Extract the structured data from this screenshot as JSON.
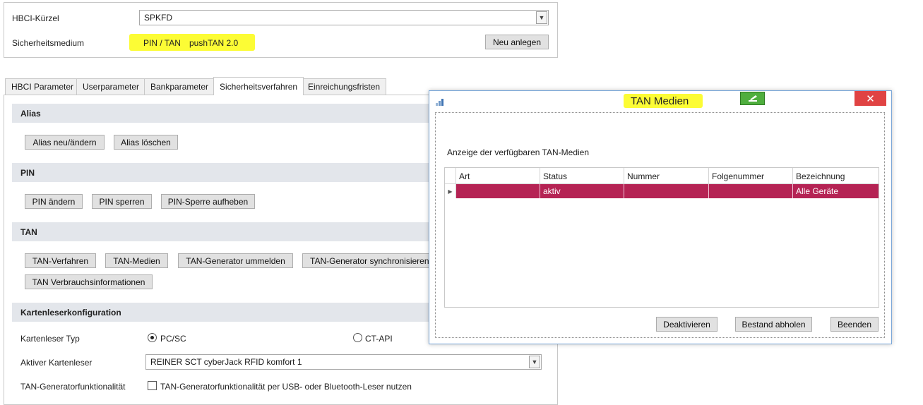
{
  "top": {
    "hbci_label": "HBCI-Kürzel",
    "hbci_value": "SPKFD",
    "medium_label": "Sicherheitsmedium",
    "medium_value_a": "PIN / TAN",
    "medium_value_b": "pushTAN 2.0",
    "new_button": "Neu anlegen"
  },
  "tabs": [
    {
      "label": "HBCI Parameter"
    },
    {
      "label": "Userparameter"
    },
    {
      "label": "Bankparameter"
    },
    {
      "label": "Sicherheitsverfahren"
    },
    {
      "label": "Einreichungsfristen"
    }
  ],
  "sections": {
    "alias": {
      "title": "Alias",
      "buttons": [
        "Alias neu/ändern",
        "Alias löschen"
      ]
    },
    "pin": {
      "title": "PIN",
      "buttons": [
        "PIN ändern",
        "PIN sperren",
        "PIN-Sperre aufheben"
      ]
    },
    "tan": {
      "title": "TAN",
      "buttons": [
        "TAN-Verfahren",
        "TAN-Medien",
        "TAN-Generator ummelden",
        "TAN-Generator synchronisieren",
        "TAN Verbrauchsinformationen"
      ]
    },
    "card": {
      "title": "Kartenleserkonfiguration",
      "type_label": "Kartenleser Typ",
      "opt_pcsc": "PC/SC",
      "opt_ctapi": "CT-API",
      "active_label": "Aktiver Kartenleser",
      "active_value": "REINER SCT cyberJack RFID komfort 1",
      "gen_label": "TAN-Generatorfunktionalität",
      "gen_checkbox": "TAN-Generatorfunktionalität per USB- oder Bluetooth-Leser nutzen"
    }
  },
  "dialog": {
    "title": "TAN Medien",
    "close": "✕",
    "caption": "Anzeige der verfügbaren TAN-Medien",
    "columns": [
      "Art",
      "Status",
      "Nummer",
      "Folgenummer",
      "Bezeichnung"
    ],
    "rows": [
      {
        "art": "",
        "status": "aktiv",
        "nummer": "",
        "folgenummer": "",
        "bezeichnung": "Alle Geräte"
      }
    ],
    "buttons": [
      "Deaktivieren",
      "Bestand abholen",
      "Beenden"
    ]
  },
  "colors": {
    "highlight": "#fcfc35",
    "selected_row": "#b52354",
    "close": "#e04343"
  }
}
